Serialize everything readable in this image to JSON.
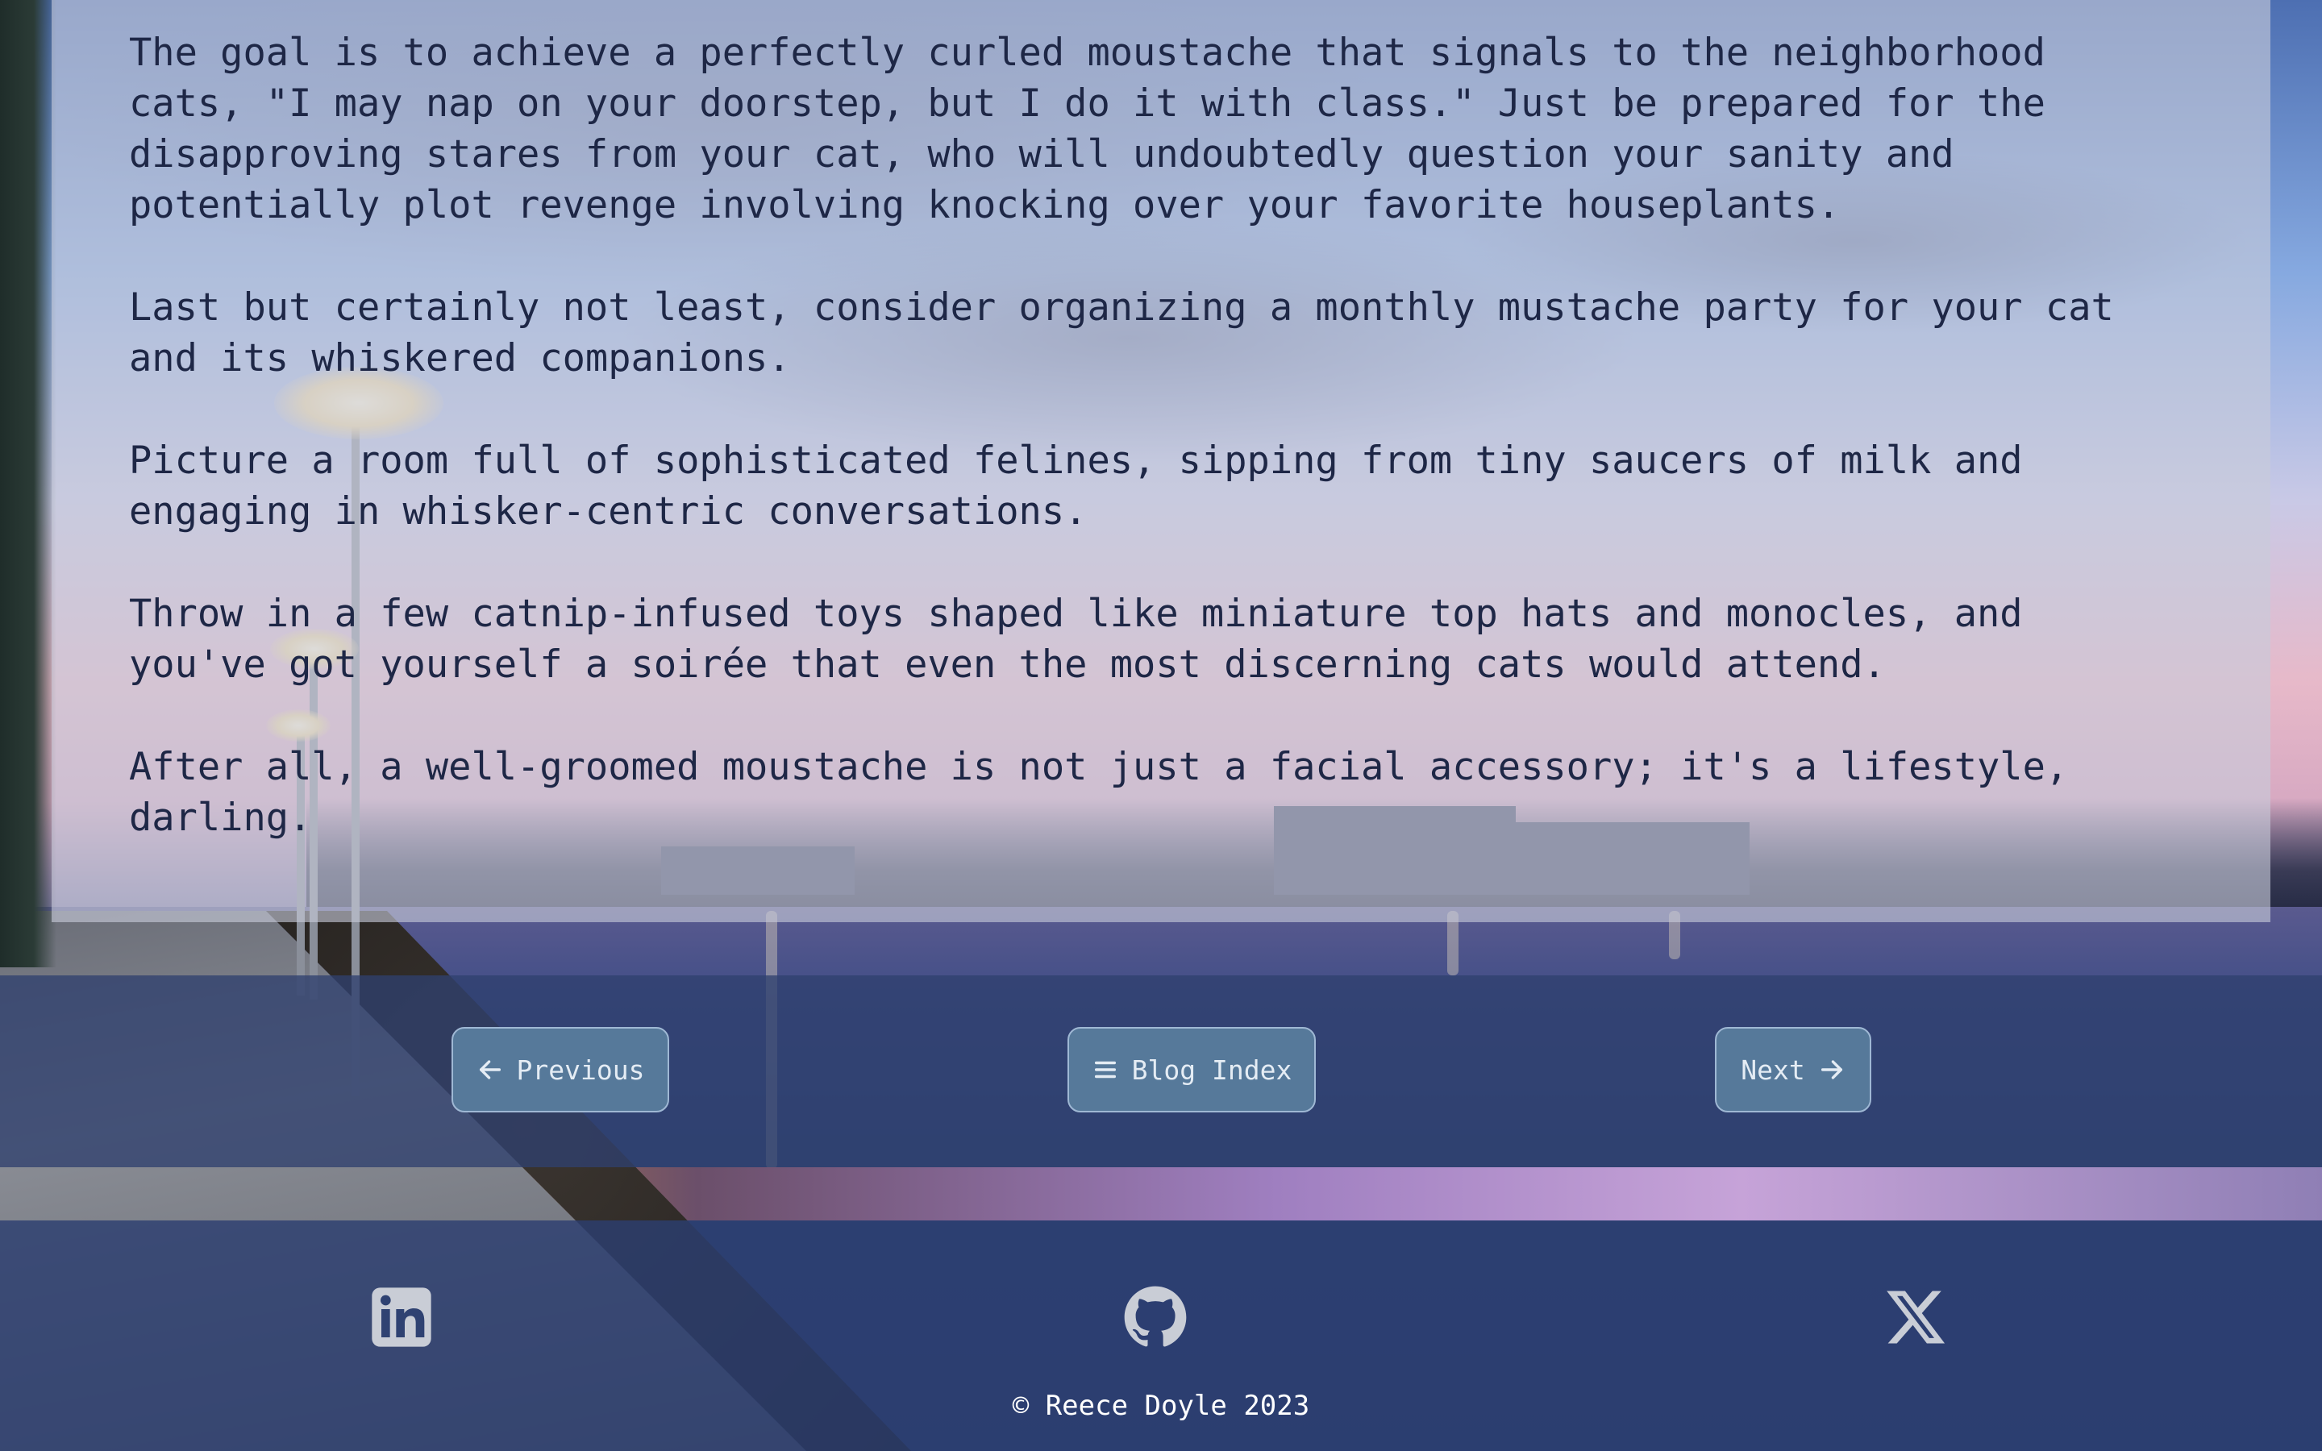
{
  "article": {
    "paragraphs": [
      "The goal is to achieve a perfectly curled moustache that signals to the neighborhood\ncats, \"I may nap on your doorstep, but I do it with class.\" Just be prepared for the\ndisapproving stares from your cat, who will undoubtedly question your sanity and\npotentially plot revenge involving knocking over your favorite houseplants.",
      "Last but certainly not least, consider organizing a monthly mustache party for your cat\nand its whiskered companions.",
      "Picture a room full of sophisticated felines, sipping from tiny saucers of milk and\nengaging in whisker-centric conversations.",
      "Throw in a few catnip-infused toys shaped like miniature top hats and monocles, and\nyou've got yourself a soirée that even the most discerning cats would attend.",
      "After all, a well-groomed moustache is not just a facial accessory; it's a lifestyle,\ndarling."
    ]
  },
  "pager": {
    "previous_label": "Previous",
    "index_label": "Blog Index",
    "next_label": "Next",
    "previous_icon": "arrow-left-icon",
    "index_icon": "menu-icon",
    "next_icon": "arrow-right-icon"
  },
  "footer": {
    "social": [
      {
        "icon": "linkedin-icon"
      },
      {
        "icon": "github-icon"
      },
      {
        "icon": "x-icon"
      }
    ],
    "copyright": "© Reece Doyle 2023"
  },
  "colors": {
    "text": "#1e2746",
    "button_bg": "#56799a",
    "button_border": "#9fb8d4",
    "footer_bg": "#2c3e70",
    "icon": "#c9cdd6"
  }
}
